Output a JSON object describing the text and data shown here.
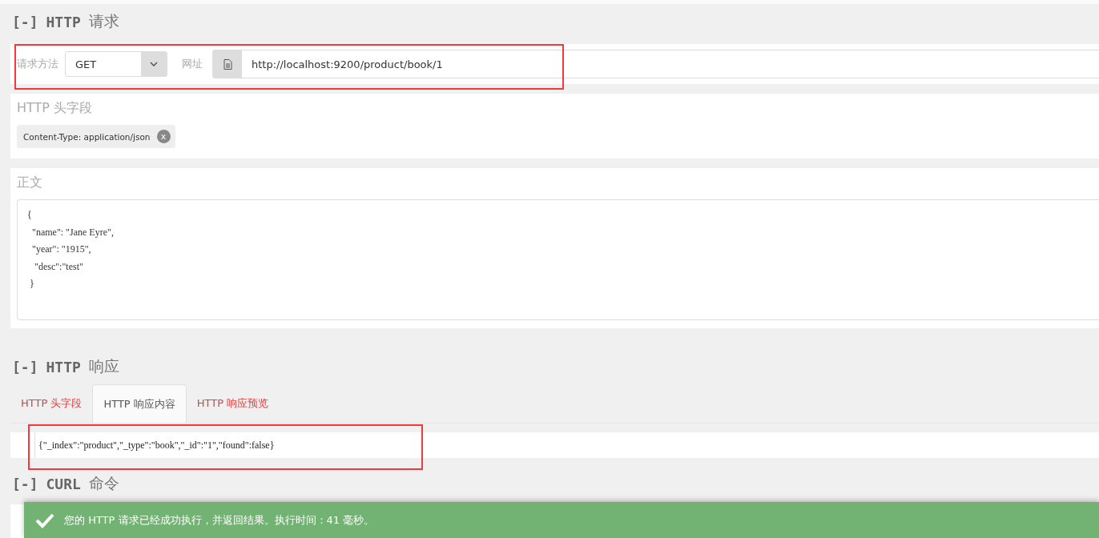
{
  "request": {
    "heading": {
      "toggle": "[-]",
      "title": "HTTP",
      "subtitle": "请求"
    },
    "method_label": "请求方法",
    "method": "GET",
    "url_label": "网址",
    "url": "http://localhost:9200/product/book/1",
    "highlighted": true
  },
  "headers": {
    "title": "HTTP 头字段",
    "tags": [
      {
        "label": "Content-Type: application/json",
        "remove": "x"
      }
    ]
  },
  "body": {
    "title": "正文",
    "lines": [
      "{",
      "  \"name\": \"Jane Eyre\",",
      "  \"year\": \"1915\",",
      "   \"desc\":\"test\"",
      " }"
    ]
  },
  "response": {
    "heading": {
      "toggle": "[-]",
      "title": "HTTP",
      "subtitle": "响应"
    },
    "tabs": [
      {
        "label": "HTTP 头字段",
        "selected": false
      },
      {
        "label": "HTTP 响应内容",
        "selected": true
      },
      {
        "label": "HTTP 响应预览",
        "selected": false
      }
    ],
    "content": "{\"_index\":\"product\",\"_type\":\"book\",\"_id\":\"1\",\"found\":false}",
    "highlighted": true
  },
  "curl": {
    "heading": {
      "toggle": "[-]",
      "title": "CURL",
      "subtitle": "命令"
    }
  },
  "toast": {
    "message": "您的 HTTP 请求已经成功执行，并返回结果。执行时间：41 毫秒。"
  }
}
